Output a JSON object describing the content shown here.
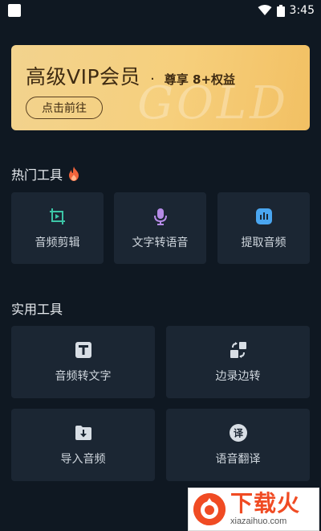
{
  "status_bar": {
    "time": "3:45"
  },
  "vip_banner": {
    "title": "高级VIP会员",
    "dot": "·",
    "subtitle": "尊享 8+权益",
    "button": "点击前往",
    "watermark": "GOLD"
  },
  "hot_tools": {
    "title": "热门工具",
    "items": [
      {
        "label": "音频剪辑",
        "icon": "video-crop-icon",
        "color": "#3cc5a6"
      },
      {
        "label": "文字转语音",
        "icon": "microphone-icon",
        "color": "#b58be6"
      },
      {
        "label": "提取音频",
        "icon": "audio-extract-icon",
        "color": "#4aa6f0"
      }
    ]
  },
  "util_tools": {
    "title": "实用工具",
    "items": [
      {
        "label": "音频转文字",
        "icon": "text-t-icon"
      },
      {
        "label": "边录边转",
        "icon": "record-convert-icon"
      },
      {
        "label": "导入音频",
        "icon": "folder-import-icon"
      },
      {
        "label": "语音翻译",
        "icon": "translate-icon"
      }
    ]
  },
  "site_logo": {
    "main": "下载火",
    "sub": "xiazaihuo.com"
  },
  "colors": {
    "background": "#0f1822",
    "card": "#1b2633",
    "vip_gold": "#f6cf7c",
    "fire": "#f0643c"
  }
}
